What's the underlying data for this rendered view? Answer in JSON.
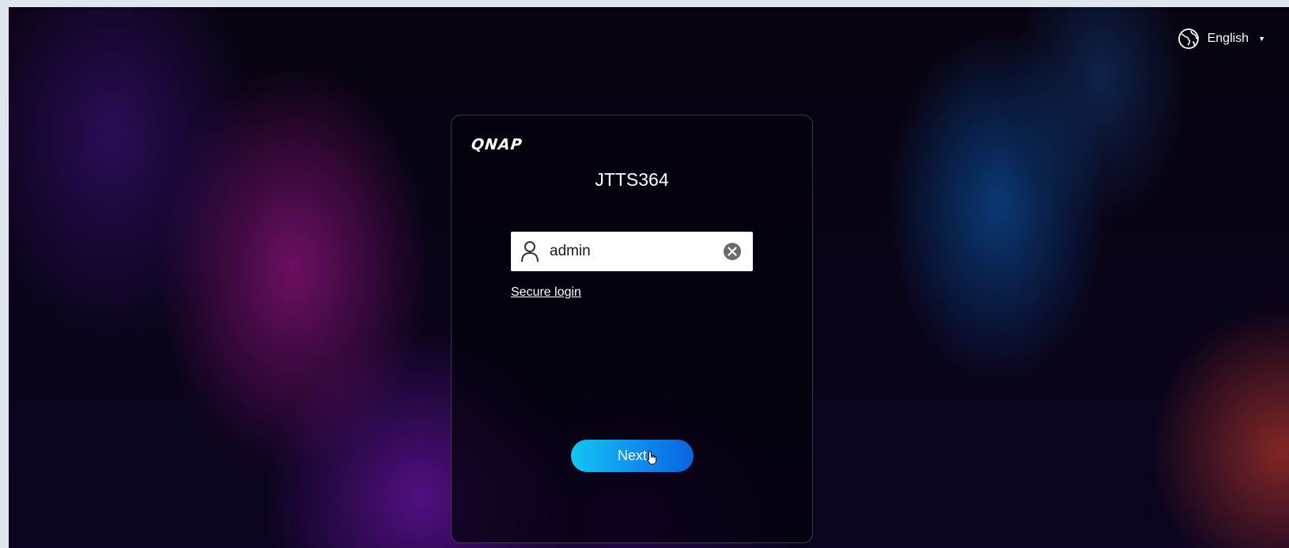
{
  "header": {
    "language_icon": "globe-icon",
    "language_label": "English",
    "language_caret": "▼"
  },
  "login": {
    "brand_logo": "QNAP",
    "device_name": "JTTS364",
    "username_icon": "user-icon",
    "username_value": "admin",
    "clear_icon": "clear-icon",
    "secure_login_label": "Secure login",
    "next_label": "Next"
  },
  "colors": {
    "next_gradient_start": "#12c6f2",
    "next_gradient_end": "#0a63e0",
    "card_border": "#3a3344"
  }
}
